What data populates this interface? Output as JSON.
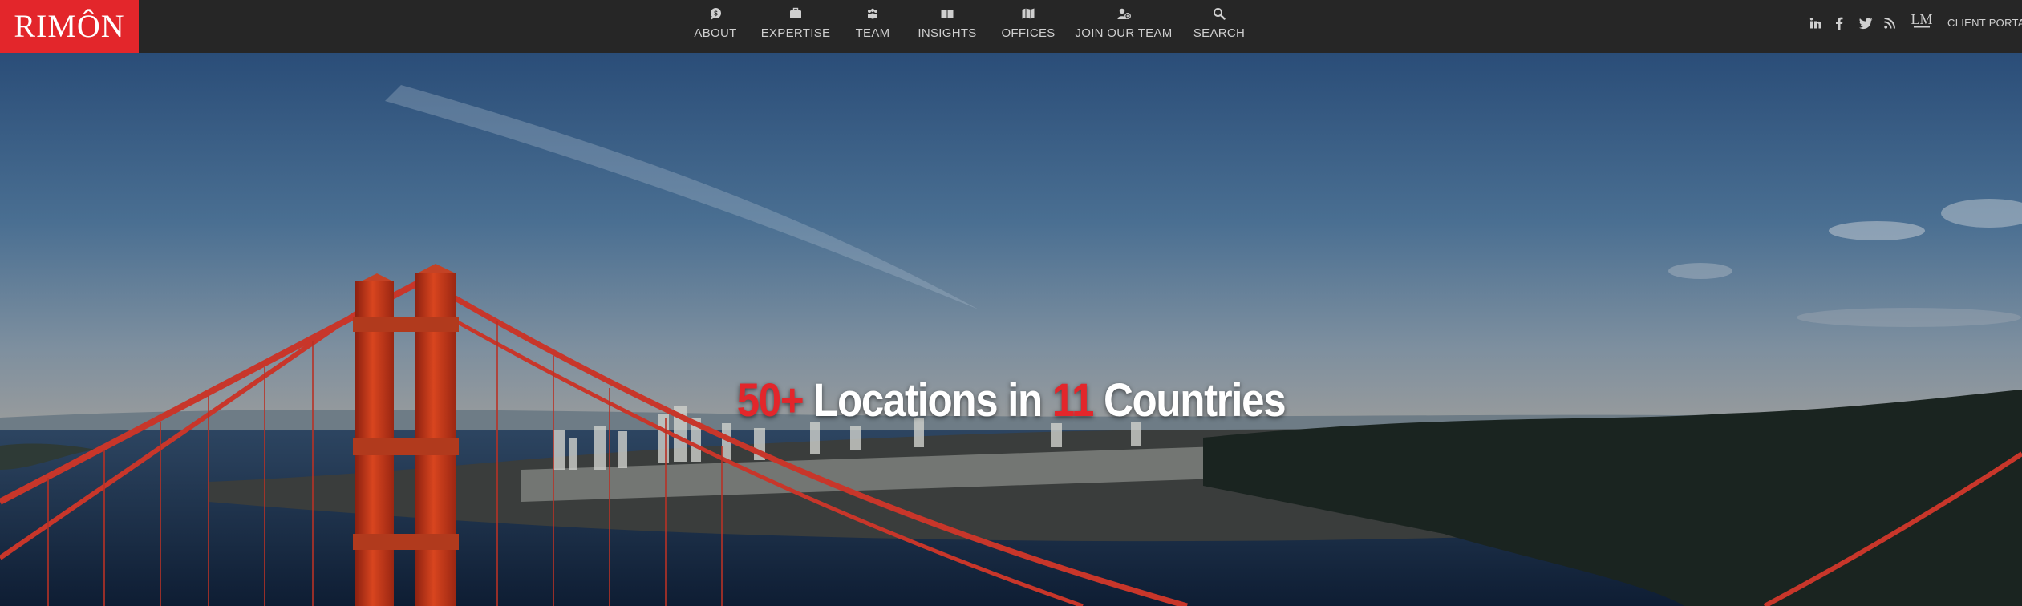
{
  "brand": {
    "name": "RIMÔN",
    "color": "#e3262b"
  },
  "nav": {
    "items": [
      {
        "label": "ABOUT",
        "icon": "chat-bubble-icon"
      },
      {
        "label": "EXPERTISE",
        "icon": "briefcase-icon"
      },
      {
        "label": "TEAM",
        "icon": "people-icon"
      },
      {
        "label": "INSIGHTS",
        "icon": "open-book-icon"
      },
      {
        "label": "OFFICES",
        "icon": "map-icon"
      },
      {
        "label": "JOIN OUR TEAM",
        "icon": "add-user-icon"
      },
      {
        "label": "SEARCH",
        "icon": "search-icon"
      }
    ]
  },
  "social": {
    "icons": [
      "linkedin-icon",
      "facebook-icon",
      "twitter-icon",
      "rss-icon",
      "lm-badge-icon"
    ],
    "lm_badge_text": "LM",
    "client_portal_label": "CLIENT PORTAL"
  },
  "hero": {
    "headline_num1": "50+",
    "headline_text1": " Locations in ",
    "headline_num2": "11",
    "headline_text2": " Countries",
    "accent_color": "#e3262b"
  }
}
